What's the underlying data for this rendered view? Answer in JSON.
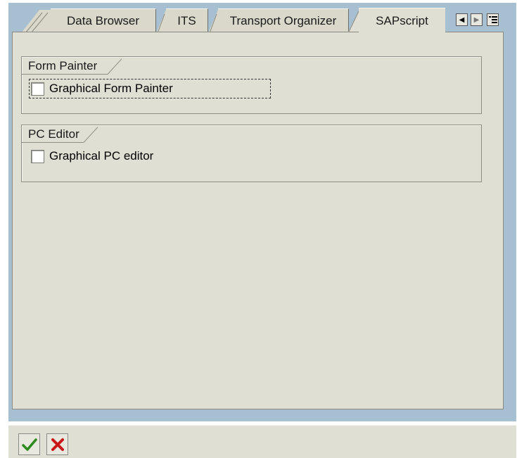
{
  "tabs": {
    "items": [
      {
        "label": "Data Browser"
      },
      {
        "label": "ITS"
      },
      {
        "label": "Transport Organizer"
      },
      {
        "label": "SAPscript"
      }
    ],
    "active": "SAPscript"
  },
  "groups": {
    "form_painter": {
      "title": "Form Painter",
      "checkbox_label": "Graphical Form Painter",
      "checked": false
    },
    "pc_editor": {
      "title": "PC Editor",
      "checkbox_label": "Graphical PC editor",
      "checked": false
    }
  },
  "nav": {
    "left_icon": "triangle-left-icon",
    "right_icon": "triangle-right-icon",
    "list_icon": "tab-list-icon"
  },
  "footer": {
    "confirm_icon": "checkmark-icon",
    "cancel_icon": "cancel-x-icon"
  },
  "colors": {
    "frame_blue": "#a6bfd1",
    "panel": "#e0dfd3",
    "confirm_green": "#2d8a1f",
    "cancel_red": "#c81818"
  }
}
